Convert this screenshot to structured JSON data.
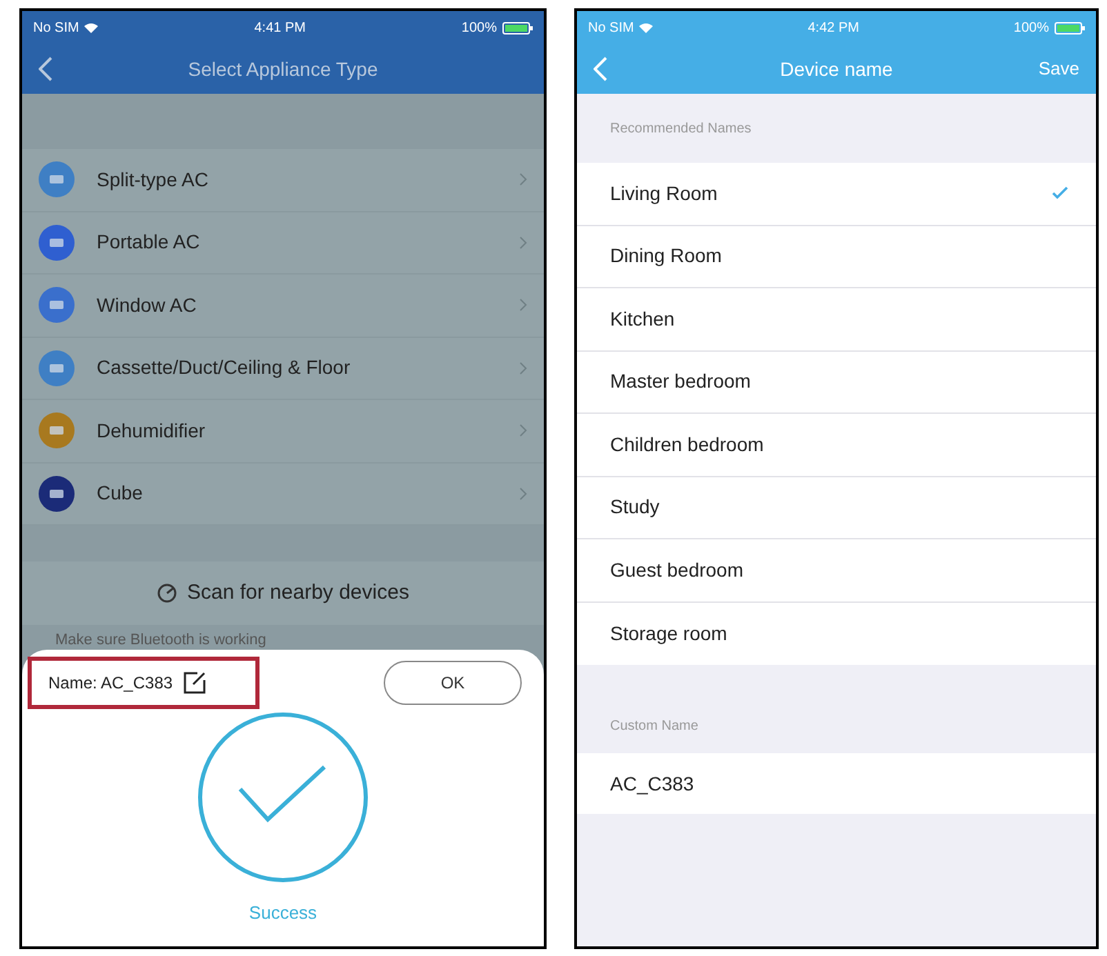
{
  "left_phone": {
    "status_bar": {
      "carrier": "No SIM",
      "time": "4:41 PM",
      "battery": "100%"
    },
    "title": "Select Appliance Type",
    "appliances": [
      {
        "label": "Split-type AC",
        "color": "#3f7fc4"
      },
      {
        "label": "Portable AC",
        "color": "#2f5fd0"
      },
      {
        "label": "Window AC",
        "color": "#3a6fcc"
      },
      {
        "label": "Cassette/Duct/Ceiling & Floor",
        "color": "#3f7fc4"
      },
      {
        "label": "Dehumidifier",
        "color": "#a8791f"
      },
      {
        "label": "Cube",
        "color": "#1b2b78"
      }
    ],
    "scan_button": "Scan for nearby devices",
    "hint": "Make sure Bluetooth is working",
    "sheet": {
      "name_label": "Name: AC_C383",
      "ok_button": "OK",
      "status": "Success"
    }
  },
  "right_phone": {
    "status_bar": {
      "carrier": "No SIM",
      "time": "4:42 PM",
      "battery": "100%"
    },
    "title": "Device name",
    "save_button": "Save",
    "recommended_header": "Recommended Names",
    "names": [
      {
        "label": "Living Room",
        "selected": true
      },
      {
        "label": "Dining Room",
        "selected": false
      },
      {
        "label": "Kitchen",
        "selected": false
      },
      {
        "label": "Master bedroom",
        "selected": false
      },
      {
        "label": "Children bedroom",
        "selected": false
      },
      {
        "label": "Study",
        "selected": false
      },
      {
        "label": "Guest bedroom",
        "selected": false
      },
      {
        "label": "Storage room",
        "selected": false
      }
    ],
    "custom_header": "Custom Name",
    "custom_value": "AC_C383"
  }
}
